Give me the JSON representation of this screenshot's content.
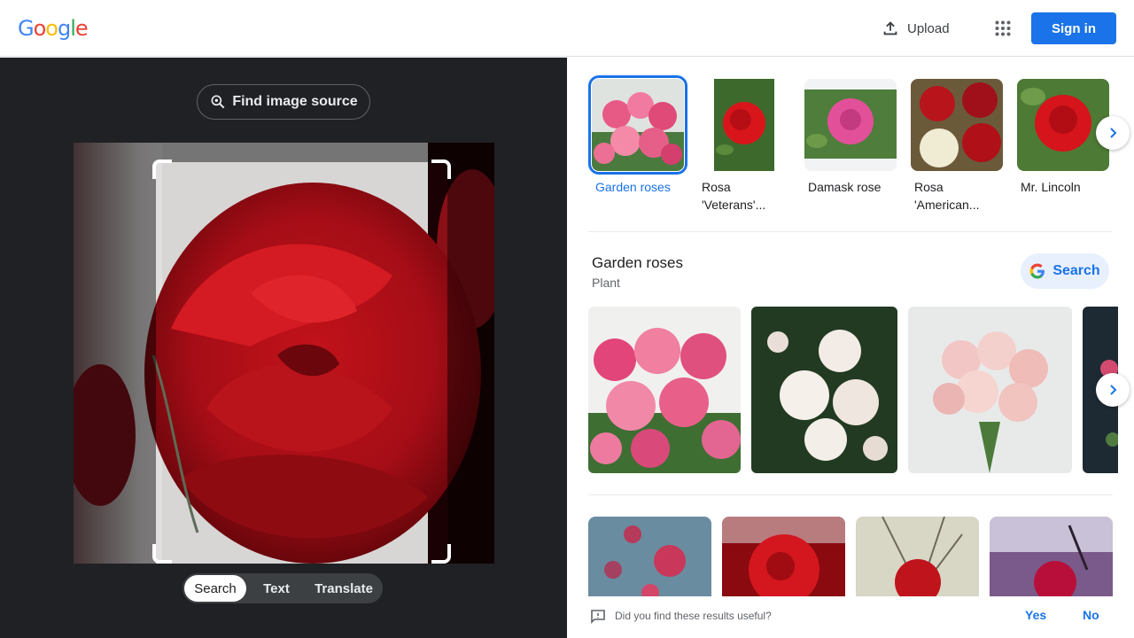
{
  "header": {
    "logo": [
      "G",
      "o",
      "o",
      "g",
      "l",
      "e"
    ],
    "logo_colors": [
      "#4285f4",
      "#ea4335",
      "#fbbc05",
      "#4285f4",
      "#34a853",
      "#ea4335"
    ],
    "upload_label": "Upload",
    "signin_label": "Sign in",
    "apps_icon": "grid-apps-icon"
  },
  "left_pane": {
    "find_source_label": "Find image source",
    "modes": [
      "Search",
      "Text",
      "Translate"
    ],
    "active_mode": "Search"
  },
  "matches": [
    {
      "label": "Garden roses",
      "selected": true
    },
    {
      "label": "Rosa 'Veterans'...",
      "selected": false
    },
    {
      "label": "Damask rose",
      "selected": false
    },
    {
      "label": "Rosa 'American...",
      "selected": false
    },
    {
      "label": "Mr. Lincoln",
      "selected": false
    }
  ],
  "entity": {
    "title": "Garden roses",
    "subtitle": "Plant",
    "search_label": "Search"
  },
  "feedback": {
    "question": "Did you find these results useful?",
    "yes": "Yes",
    "no": "No"
  },
  "colors": {
    "accent": "#1a73e8",
    "dark_bg": "#202124"
  }
}
